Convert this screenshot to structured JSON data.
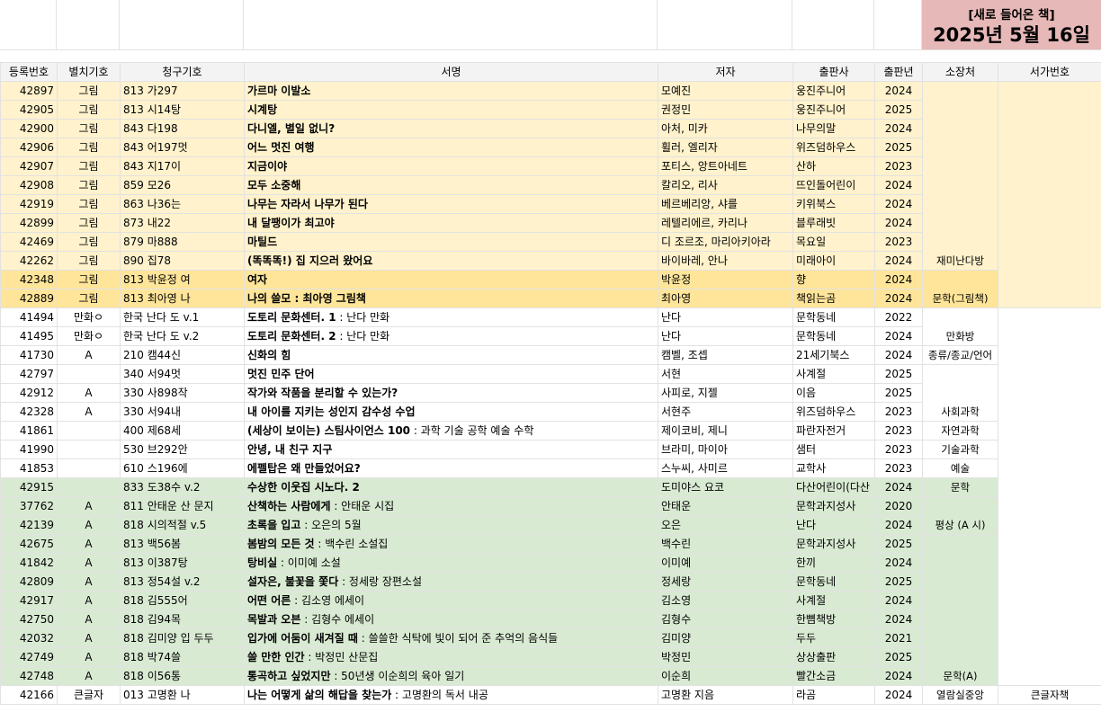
{
  "banner": {
    "line1": "[새로 들어온 책]",
    "line2": "2025년 5월 16일"
  },
  "headers": [
    "등록번호",
    "별치기호",
    "청구기호",
    "서명",
    "저자",
    "출판사",
    "출판년",
    "소장처",
    "서가번호"
  ],
  "rows": [
    {
      "reg": "42897",
      "sep": "그림",
      "call": "813 가297",
      "title": "가르마 이발소",
      "sub": "",
      "author": "모예진",
      "pub": "웅진주니어",
      "year": "2024",
      "color": "y"
    },
    {
      "reg": "42905",
      "sep": "그림",
      "call": "813 시14탕",
      "title": "시계탕",
      "sub": "",
      "author": "권정민",
      "pub": "웅진주니어",
      "year": "2025",
      "color": "y"
    },
    {
      "reg": "42900",
      "sep": "그림",
      "call": "843 다198",
      "title": "다니엘, 별일 없니?",
      "sub": "",
      "author": "아처, 미카",
      "pub": "나무의말",
      "year": "2024",
      "color": "y"
    },
    {
      "reg": "42906",
      "sep": "그림",
      "call": "843 어197멋",
      "title": "어느 멋진 여행",
      "sub": "",
      "author": "휠러, 엘리자",
      "pub": "위즈덤하우스",
      "year": "2025",
      "color": "y"
    },
    {
      "reg": "42907",
      "sep": "그림",
      "call": "843 지17이",
      "title": "지금이야",
      "sub": "",
      "author": "포티스, 앙트아네트",
      "pub": "산하",
      "year": "2023",
      "color": "y"
    },
    {
      "reg": "42908",
      "sep": "그림",
      "call": "859 모26",
      "title": "모두 소중해",
      "sub": "",
      "author": "칼리오, 리사",
      "pub": "뜨인돌어린이",
      "year": "2024",
      "color": "y"
    },
    {
      "reg": "42919",
      "sep": "그림",
      "call": "863 나36는",
      "title": "나무는 자라서 나무가 된다",
      "sub": "",
      "author": "베르베리앙, 샤를",
      "pub": "키위북스",
      "year": "2024",
      "color": "y"
    },
    {
      "reg": "42899",
      "sep": "그림",
      "call": "873 내22",
      "title": "내 달팽이가 최고야",
      "sub": "",
      "author": "레텔리에르, 카리나",
      "pub": "블루래빗",
      "year": "2024",
      "color": "y"
    },
    {
      "reg": "42469",
      "sep": "그림",
      "call": "879 마888",
      "title": "마틸드",
      "sub": "",
      "author": "디 조르조, 마리아키아라",
      "pub": "목요일",
      "year": "2023",
      "color": "y"
    },
    {
      "reg": "42262",
      "sep": "그림",
      "call": "890 집78",
      "title": "(똑똑똑!) 집 지으러 왔어요",
      "sub": "",
      "author": "바이바레, 안나",
      "pub": "미래아이",
      "year": "2024",
      "color": "y"
    },
    {
      "reg": "42348",
      "sep": "그림",
      "call": "813 박윤정 여",
      "title": "여자",
      "sub": "",
      "author": "박윤정",
      "pub": "향",
      "year": "2024",
      "color": "o"
    },
    {
      "reg": "42889",
      "sep": "그림",
      "call": "813 최아영 나",
      "title": "나의 쓸모 : 최아영 그림책",
      "sub": "",
      "author": "최아영",
      "pub": "책읽는곰",
      "year": "2024",
      "color": "o"
    },
    {
      "reg": "41494",
      "sep": "만화ㅇ",
      "call": "한국 난다 도 v.1",
      "title": "도토리 문화센터. 1",
      "sub": " : 난다 만화",
      "author": "난다",
      "pub": "문학동네",
      "year": "2022",
      "color": "w"
    },
    {
      "reg": "41495",
      "sep": "만화ㅇ",
      "call": "한국 난다 도 v.2",
      "title": "도토리 문화센터. 2",
      "sub": " : 난다 만화",
      "author": "난다",
      "pub": "문학동네",
      "year": "2024",
      "color": "w"
    },
    {
      "reg": "41730",
      "sep": "A",
      "call": "210 캠44신",
      "title": "신화의 힘",
      "sub": "",
      "author": "캠벨, 조셉",
      "pub": "21세기북스",
      "year": "2024",
      "color": "w"
    },
    {
      "reg": "42797",
      "sep": "",
      "call": "340 서94멋",
      "title": "멋진 민주 단어",
      "sub": "",
      "author": "서현",
      "pub": "사계절",
      "year": "2025",
      "color": "w"
    },
    {
      "reg": "42912",
      "sep": "A",
      "call": "330 사898작",
      "title": "작가와 작품을 분리할 수 있는가?",
      "sub": "",
      "author": "사피로, 지젤",
      "pub": "이음",
      "year": "2025",
      "color": "w"
    },
    {
      "reg": "42328",
      "sep": "A",
      "call": "330 서94내",
      "title": "내 아이를 지키는 성인지 감수성 수업",
      "sub": "",
      "author": "서현주",
      "pub": "위즈덤하우스",
      "year": "2023",
      "color": "w"
    },
    {
      "reg": "41861",
      "sep": "",
      "call": "400 제68세",
      "title": "(세상이 보이는) 스팀사이언스 100",
      "sub": " : 과학 기술 공학 예술 수학",
      "author": "제이코비, 제니",
      "pub": "파란자전거",
      "year": "2023",
      "color": "w"
    },
    {
      "reg": "41990",
      "sep": "",
      "call": "530 브292안",
      "title": "안녕, 내 친구 지구",
      "sub": "",
      "author": "브라미, 마이아",
      "pub": "샘터",
      "year": "2023",
      "color": "w"
    },
    {
      "reg": "41853",
      "sep": "",
      "call": "610 스196에",
      "title": "에펠탑은 왜 만들었어요?",
      "sub": "",
      "author": "스누씨, 사미르",
      "pub": "교학사",
      "year": "2023",
      "color": "w"
    },
    {
      "reg": "42915",
      "sep": "",
      "call": "833 도38수 v.2",
      "title": "수상한 이웃집 시노다. 2",
      "sub": "",
      "author": "도미야스 요코",
      "pub": "다산어린이(다산",
      "year": "2024",
      "color": "g"
    },
    {
      "reg": "37762",
      "sep": "A",
      "call": "811 안태운 산 문지",
      "title": "산책하는 사람에게",
      "sub": " : 안태운 시집",
      "author": "안태운",
      "pub": "문학과지성사",
      "year": "2020",
      "color": "g"
    },
    {
      "reg": "42139",
      "sep": "A",
      "call": "818 시의적절 v.5",
      "title": "초록을 입고",
      "sub": " : 오은의 5월",
      "author": "오은",
      "pub": "난다",
      "year": "2024",
      "color": "g"
    },
    {
      "reg": "42675",
      "sep": "A",
      "call": "813 백56봄",
      "title": "봄밤의 모든 것",
      "sub": " : 백수린 소설집",
      "author": "백수린",
      "pub": "문학과지성사",
      "year": "2025",
      "color": "g"
    },
    {
      "reg": "41842",
      "sep": "A",
      "call": "813 이387탕",
      "title": "탕비실",
      "sub": " : 이미예 소설",
      "author": "이미예",
      "pub": "한끼",
      "year": "2024",
      "color": "g"
    },
    {
      "reg": "42809",
      "sep": "A",
      "call": "813 정54설 v.2",
      "title": "설자은, 불꽃을 쫓다",
      "sub": " : 정세랑 장편소설",
      "author": "정세랑",
      "pub": "문학동네",
      "year": "2025",
      "color": "g"
    },
    {
      "reg": "42917",
      "sep": "A",
      "call": "818 김555어",
      "title": "어떤 어른",
      "sub": " : 김소영 에세이",
      "author": "김소영",
      "pub": "사계절",
      "year": "2024",
      "color": "g"
    },
    {
      "reg": "42750",
      "sep": "A",
      "call": "818 김94목",
      "title": "목발과 오븐",
      "sub": " : 김형수 에세이",
      "author": "김형수",
      "pub": "한뼘책방",
      "year": "2024",
      "color": "g"
    },
    {
      "reg": "42032",
      "sep": "A",
      "call": "818 김미양 입 두두",
      "title": "입가에 어둠이 새겨질 때",
      "sub": " : 쓸쓸한 식탁에 빛이 되어 준 추억의 음식들",
      "author": "김미양",
      "pub": "두두",
      "year": "2021",
      "color": "g"
    },
    {
      "reg": "42749",
      "sep": "A",
      "call": "818 박74쓸",
      "title": "쓸 만한 인간",
      "sub": " : 박정민 산문집",
      "author": "박정민",
      "pub": "상상출판",
      "year": "2025",
      "color": "g"
    },
    {
      "reg": "42748",
      "sep": "A",
      "call": "818 이56통",
      "title": "통곡하고 싶었지만",
      "sub": " : 50년생 이순희의 육아 일기",
      "author": "이순희",
      "pub": "빨간소금",
      "year": "2024",
      "color": "g"
    },
    {
      "reg": "42166",
      "sep": "큰글자",
      "call": "013 고명환 나",
      "title": "나는 어떻게 삶의 해답을 찾는가",
      "sub": " : 고명환의 독서 내공",
      "author": "고명환 지음",
      "pub": "라곰",
      "year": "2024",
      "color": "w"
    }
  ],
  "locations": [
    {
      "start": 0,
      "span": 10,
      "label": "재미난다방",
      "color": "y"
    },
    {
      "start": 10,
      "span": 2,
      "label": "문학(그림책)",
      "color": "o"
    },
    {
      "start": 12,
      "span": 2,
      "label": "만화방",
      "color": "w"
    },
    {
      "start": 14,
      "span": 1,
      "label": "종류/종교/언어",
      "color": "w"
    },
    {
      "start": 15,
      "span": 3,
      "label": "사회과학",
      "color": "w"
    },
    {
      "start": 18,
      "span": 1,
      "label": "자연과학",
      "color": "w"
    },
    {
      "start": 19,
      "span": 1,
      "label": "기술과학",
      "color": "w"
    },
    {
      "start": 20,
      "span": 1,
      "label": "예술",
      "color": "w"
    },
    {
      "start": 21,
      "span": 1,
      "label": "문학",
      "color": "g"
    },
    {
      "start": 22,
      "span": 2,
      "label": "평상 (A 시)",
      "color": "g"
    },
    {
      "start": 24,
      "span": 8,
      "label": "문학(A)",
      "color": "g"
    },
    {
      "start": 32,
      "span": 1,
      "label": "열람실중앙",
      "color": "w"
    }
  ],
  "shelves": [
    {
      "start": 0,
      "span": 12,
      "label": "",
      "color": "y"
    },
    {
      "start": 12,
      "span": 20,
      "label": "",
      "color": "w"
    },
    {
      "start": 32,
      "span": 1,
      "label": "큰글자책",
      "color": "w"
    }
  ]
}
